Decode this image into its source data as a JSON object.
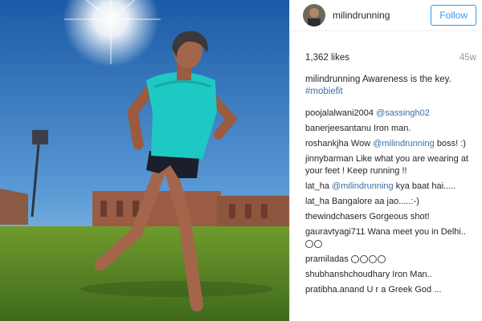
{
  "post": {
    "username": "milindrunning",
    "follow_label": "Follow",
    "likes": "1,362 likes",
    "age": "45w",
    "caption_user": "milindrunning",
    "caption_text": "Awareness is the key.",
    "caption_hashtag": "#mobiefit"
  },
  "comments": [
    {
      "user": "poojalalwani2004",
      "mention": "@sassingh02",
      "text": ""
    },
    {
      "user": "banerjeesantanu",
      "mention": "",
      "text": "Iron man."
    },
    {
      "user": "roshankjha",
      "pre": "Wow",
      "mention": "@milindrunning",
      "text": "boss! :)"
    },
    {
      "user": "jinnybarman",
      "mention": "",
      "text": "Like what you are wearing at your feet ! Keep running !!"
    },
    {
      "user": "lat_ha",
      "mention": "@milindrunning",
      "text": "kya baat hai....."
    },
    {
      "user": "lat_ha",
      "mention": "",
      "text": "Bangalore aa jao.....:-)"
    },
    {
      "user": "thewindchasers",
      "mention": "",
      "text": "Gorgeous shot!"
    },
    {
      "user": "gauravtyagi711",
      "mention": "",
      "text": "Wana meet you in Delhi.."
    },
    {
      "user": "pramiladas",
      "mention": "",
      "text": ""
    },
    {
      "user": "shubhanshchoudhary",
      "mention": "",
      "text": "Iron Man.."
    },
    {
      "user": "pratibha.anand",
      "mention": "",
      "text": "U r a Greek God ..."
    }
  ],
  "icons": {
    "avatar": "avatar",
    "emoji": "smiley-icon"
  },
  "colors": {
    "accent": "#3897f0",
    "link": "#3b6fa8",
    "shirt": "#1ec9c3",
    "sky": "#2a6db2",
    "grass": "#5a8a2b"
  }
}
